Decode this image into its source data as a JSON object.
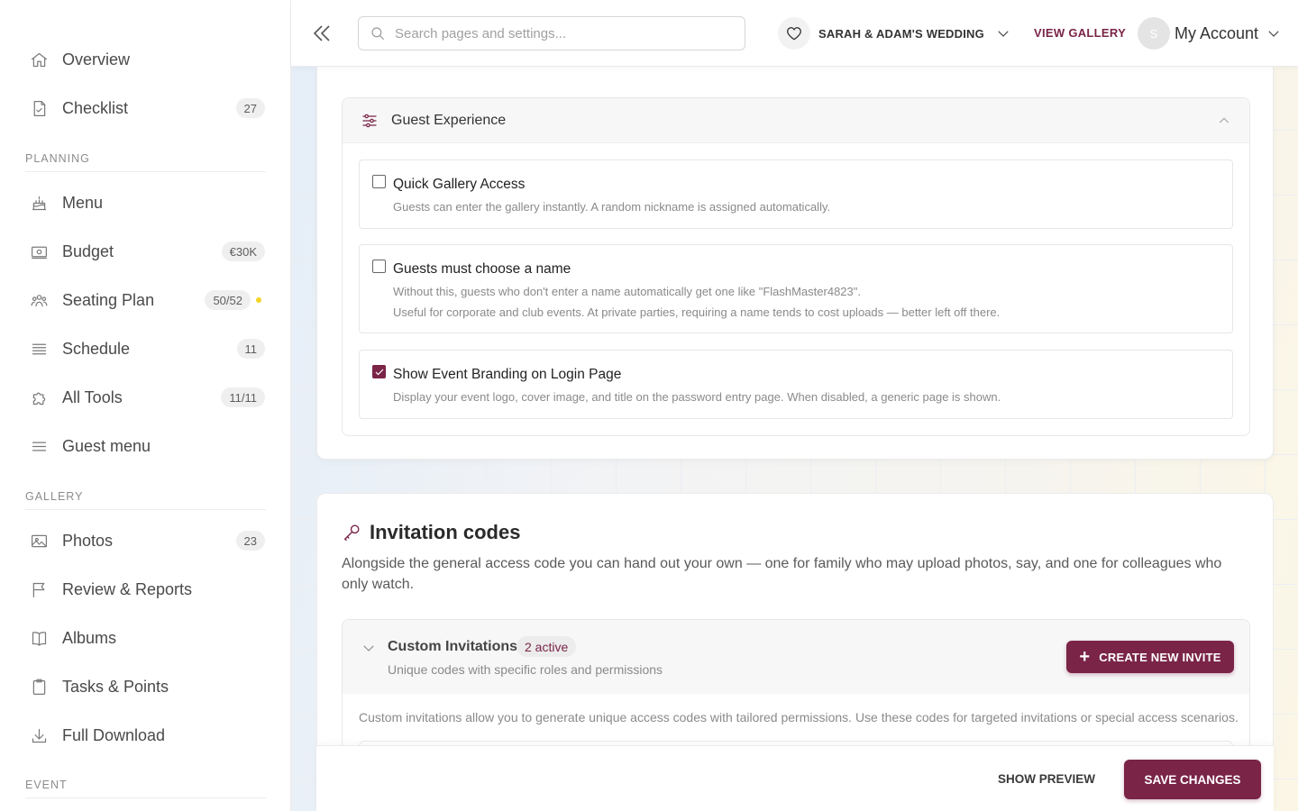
{
  "sidebar": {
    "items_top": [
      {
        "label": "Overview",
        "icon": "home-icon"
      },
      {
        "label": "Checklist",
        "icon": "checklist-icon",
        "badge": "27"
      }
    ],
    "sections": [
      {
        "label": "PLANNING"
      },
      {
        "label": "GALLERY"
      },
      {
        "label": "EVENT"
      }
    ],
    "planning": [
      {
        "label": "Menu",
        "icon": "cake-icon"
      },
      {
        "label": "Budget",
        "icon": "money-icon",
        "badge": "€30K"
      },
      {
        "label": "Seating Plan",
        "icon": "people-icon",
        "badge": "50/52",
        "dot_color": "#f3d427"
      },
      {
        "label": "Schedule",
        "icon": "schedule-icon",
        "badge": "11"
      },
      {
        "label": "All Tools",
        "icon": "puzzle-icon",
        "badge": "11/11"
      },
      {
        "label": "Guest menu",
        "icon": "menu-icon"
      }
    ],
    "gallery": [
      {
        "label": "Photos",
        "icon": "image-icon",
        "badge": "23"
      },
      {
        "label": "Review & Reports",
        "icon": "flag-icon"
      },
      {
        "label": "Albums",
        "icon": "book-icon"
      },
      {
        "label": "Tasks & Points",
        "icon": "clipboard-icon"
      },
      {
        "label": "Full Download",
        "icon": "download-icon"
      }
    ]
  },
  "header": {
    "search_placeholder": "Search pages and settings...",
    "event_name": "SARAH & ADAM'S WEDDING",
    "view_gallery": "VIEW GALLERY",
    "avatar_initial": "S",
    "account_label": "My Account"
  },
  "guest_experience": {
    "title": "Guest Experience",
    "options": [
      {
        "title": "Quick Gallery Access",
        "checked": false,
        "desc": [
          "Guests can enter the gallery instantly. A random nickname is assigned automatically."
        ]
      },
      {
        "title": "Guests must choose a name",
        "checked": false,
        "desc": [
          "Without this, guests who don't enter a name automatically get one like \"FlashMaster4823\".",
          "Useful for corporate and club events. At private parties, requiring a name tends to cost uploads — better left off there."
        ]
      },
      {
        "title": "Show Event Branding on Login Page",
        "checked": true,
        "desc": [
          "Display your event logo, cover image, and title on the password entry page. When disabled, a generic page is shown."
        ]
      }
    ]
  },
  "invitation_codes": {
    "title": "Invitation codes",
    "description": "Alongside the general access code you can hand out your own — one for family who may upload photos, say, and one for colleagues who only watch.",
    "custom_title": "Custom Invitations",
    "active_badge": "2 active",
    "custom_subtitle": "Unique codes with specific roles and permissions",
    "create_button": "CREATE NEW INVITE",
    "body_text": "Custom invitations allow you to generate unique access codes with tailored permissions. Use these codes for targeted invitations or special access scenarios."
  },
  "footer": {
    "show_preview": "SHOW PREVIEW",
    "save_changes": "SAVE CHANGES"
  },
  "colors": {
    "accent": "#7a2447",
    "dot": "#f3d427"
  }
}
